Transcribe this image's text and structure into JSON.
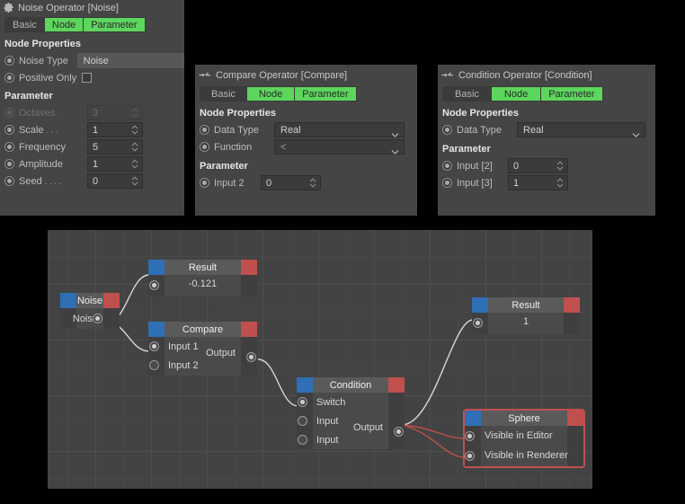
{
  "panels": [
    {
      "icon": "gear-icon",
      "title": "Noise Operator [Noise]",
      "tabs": [
        {
          "label": "Basic",
          "active": false
        },
        {
          "label": "Node",
          "active": true
        },
        {
          "label": "Parameter",
          "active": true
        }
      ],
      "sections": [
        {
          "heading": "Node Properties",
          "rows": [
            {
              "label": "Noise Type",
              "control": "combo-flat",
              "value": "Noise"
            },
            {
              "label": "Positive Only",
              "control": "checkbox",
              "value": ""
            }
          ]
        },
        {
          "heading": "Parameter",
          "rows": [
            {
              "label": "Octaves",
              "dots": ".",
              "control": "spinner",
              "value": "3",
              "disabled": true
            },
            {
              "label": "Scale",
              "dots": "...",
              "control": "spinner",
              "value": "1"
            },
            {
              "label": "Frequency",
              "dots": "",
              "control": "spinner",
              "value": "5"
            },
            {
              "label": "Amplitude",
              "dots": "",
              "control": "spinner",
              "value": "1"
            },
            {
              "label": "Seed",
              "dots": "....",
              "control": "spinner",
              "value": "0"
            }
          ]
        }
      ]
    },
    {
      "icon": "node-link-icon",
      "title": "Compare Operator [Compare]",
      "tabs": [
        {
          "label": "Basic",
          "active": false
        },
        {
          "label": "Node",
          "active": true
        },
        {
          "label": "Parameter",
          "active": true
        }
      ],
      "sections": [
        {
          "heading": "Node Properties",
          "rows": [
            {
              "label": "Data Type",
              "control": "combo",
              "value": "Real"
            },
            {
              "label": "Function",
              "control": "combo",
              "value": "<"
            }
          ]
        },
        {
          "heading": "Parameter",
          "rows": [
            {
              "label": "Input 2",
              "control": "spinner",
              "value": "0"
            }
          ]
        }
      ]
    },
    {
      "icon": "node-link-icon",
      "title": "Condition Operator [Condition]",
      "tabs": [
        {
          "label": "Basic",
          "active": false
        },
        {
          "label": "Node",
          "active": true
        },
        {
          "label": "Parameter",
          "active": true
        }
      ],
      "sections": [
        {
          "heading": "Node Properties",
          "rows": [
            {
              "label": "Data Type",
              "control": "combo",
              "value": "Real"
            }
          ]
        },
        {
          "heading": "Parameter",
          "rows": [
            {
              "label": "Input [2]",
              "control": "spinner",
              "value": "0"
            },
            {
              "label": "Input [3]",
              "control": "spinner",
              "value": "1"
            }
          ]
        }
      ]
    }
  ],
  "graph": {
    "nodes": [
      {
        "name": "noise-node",
        "title": "Noise",
        "selected": false,
        "outputs": [
          {
            "label": "Noise",
            "filled": true
          }
        ],
        "inputs": []
      },
      {
        "name": "result-node-top",
        "title": "Result",
        "selected": false,
        "value": "-0.121",
        "inputs": [
          {
            "label": "",
            "filled": true
          }
        ]
      },
      {
        "name": "compare-node",
        "title": "Compare",
        "selected": false,
        "inputs": [
          {
            "label": "Input 1",
            "filled": true
          },
          {
            "label": "Input 2",
            "filled": false
          }
        ],
        "outputs": [
          {
            "label": "Output",
            "filled": true
          }
        ]
      },
      {
        "name": "condition-node",
        "title": "Condition",
        "selected": false,
        "inputs": [
          {
            "label": "Switch",
            "filled": true
          },
          {
            "label": "Input",
            "filled": false
          },
          {
            "label": "Input",
            "filled": false
          }
        ],
        "outputs": [
          {
            "label": "Output",
            "filled": true
          }
        ]
      },
      {
        "name": "result-node-right",
        "title": "Result",
        "selected": false,
        "value": "1",
        "inputs": [
          {
            "label": "",
            "filled": true
          }
        ]
      },
      {
        "name": "sphere-node",
        "title": "Sphere",
        "selected": true,
        "inputs": [
          {
            "label": "Visible in Editor",
            "filled": true
          },
          {
            "label": "Visible in Renderer",
            "filled": true
          }
        ]
      }
    ]
  },
  "colors": {
    "accent_green": "#5cd65c",
    "node_input_blue": "#2f6fb5",
    "node_output_red": "#c0504d",
    "panel_bg": "#454545",
    "graph_bg": "#434343",
    "selection_red": "#c0504d"
  }
}
